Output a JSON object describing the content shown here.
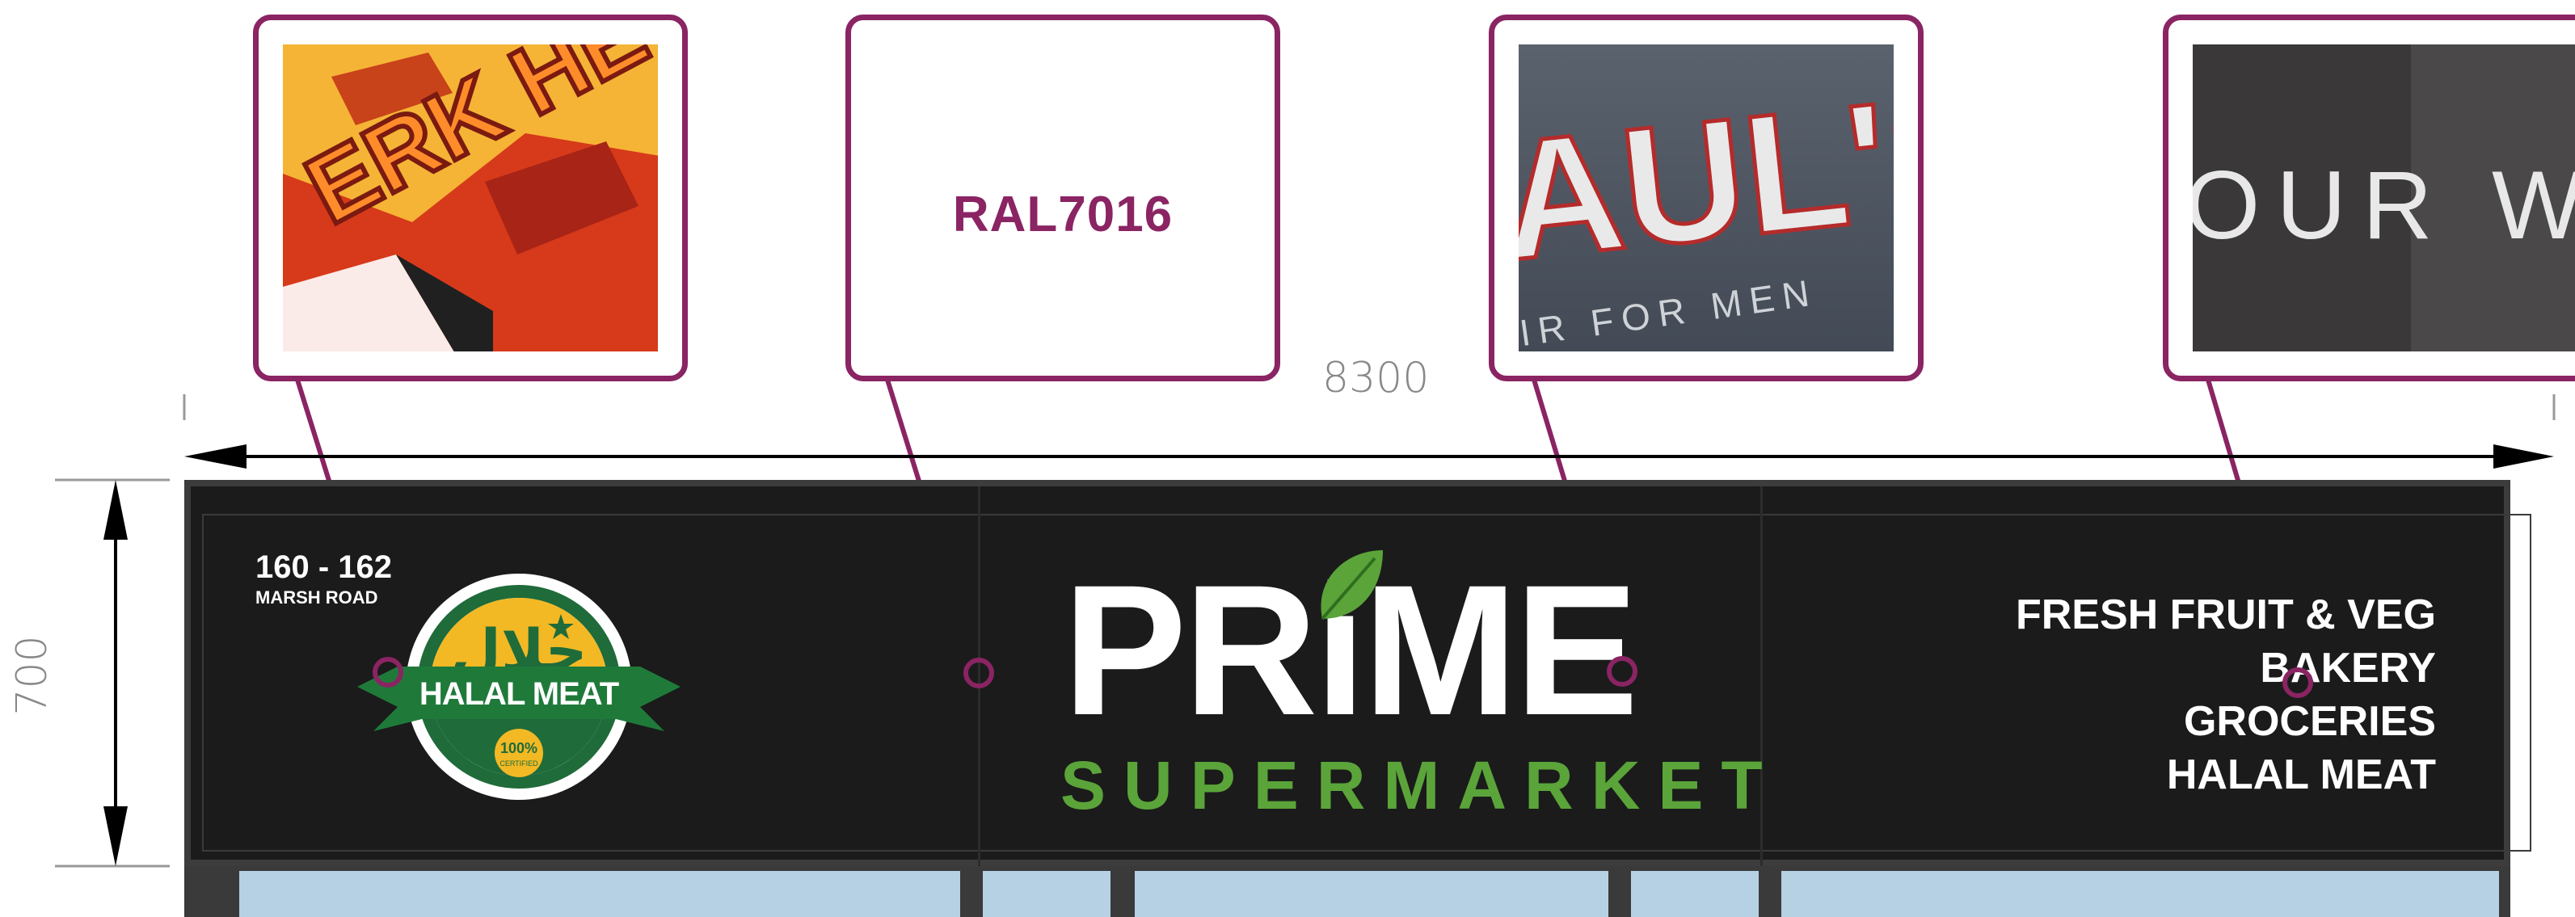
{
  "dimensions": {
    "width_label": "8300",
    "height_label": "700"
  },
  "callouts": {
    "finish_1_sample": "ERK HE",
    "colour_label": "RAL7016",
    "finish_3_sample_main": "AUL'S",
    "finish_3_sample_sub": "IR FOR MEN",
    "finish_4_sample": "OUR W"
  },
  "fascia": {
    "address_number": "160 - 162",
    "address_road": "MARSH ROAD",
    "badge": {
      "arabic": "حلال",
      "ribbon": "HALAL MEAT",
      "seal_line1": "100%",
      "seal_line2": "CERTIFIED"
    },
    "logo": {
      "prime_pr": "PR",
      "prime_i": "i",
      "prime_me": "ME",
      "subtitle": "SUPERMARKET"
    },
    "services": [
      "FRESH FRUIT & VEG",
      "BAKERY",
      "GROCERIES",
      "HALAL MEAT"
    ]
  },
  "colors": {
    "callout_border": "#8a2463",
    "fascia_background": "#1b1b1b",
    "logo_green": "#5aa43a",
    "window_glass": "#b6d1e4"
  },
  "icons": [
    "leaf-icon",
    "halal-badge-icon",
    "dimension-arrow-icon"
  ]
}
